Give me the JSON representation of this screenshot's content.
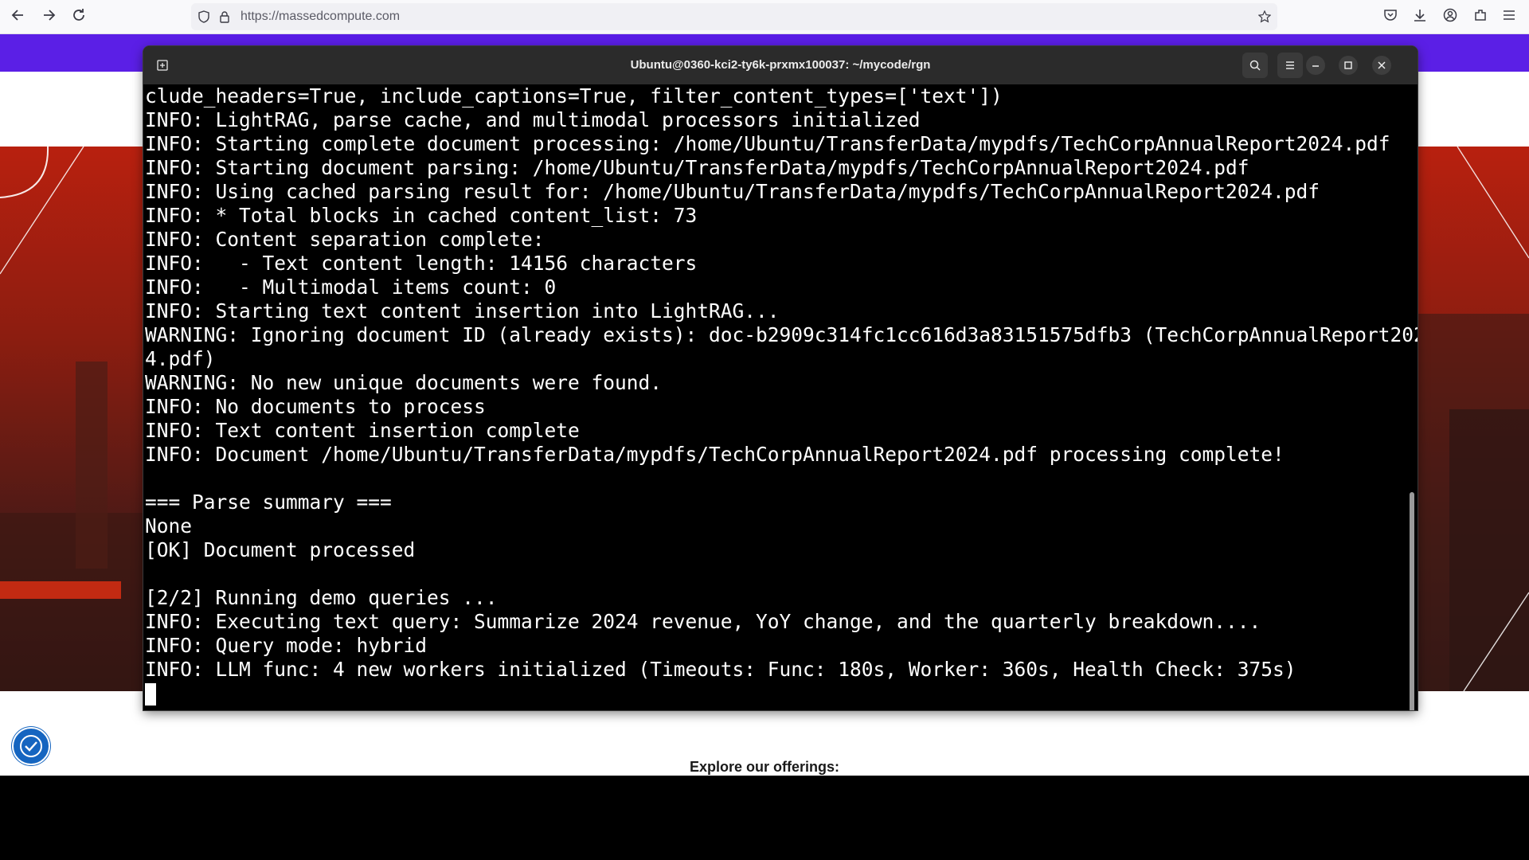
{
  "browser": {
    "url": "https://massedcompute.com"
  },
  "terminal": {
    "title": "Ubuntu@0360-kci2-ty6k-prxmx100037: ~/mycode/rgn",
    "lines": [
      "clude_headers=True, include_captions=True, filter_content_types=['text'])",
      "INFO: LightRAG, parse cache, and multimodal processors initialized",
      "INFO: Starting complete document processing: /home/Ubuntu/TransferData/mypdfs/TechCorpAnnualReport2024.pdf",
      "INFO: Starting document parsing: /home/Ubuntu/TransferData/mypdfs/TechCorpAnnualReport2024.pdf",
      "INFO: Using cached parsing result for: /home/Ubuntu/TransferData/mypdfs/TechCorpAnnualReport2024.pdf",
      "INFO: * Total blocks in cached content_list: 73",
      "INFO: Content separation complete:",
      "INFO:   - Text content length: 14156 characters",
      "INFO:   - Multimodal items count: 0",
      "INFO: Starting text content insertion into LightRAG...",
      "WARNING: Ignoring document ID (already exists): doc-b2909c314fc1cc616d3a83151575dfb3 (TechCorpAnnualReport202",
      "4.pdf)",
      "WARNING: No new unique documents were found.",
      "INFO: No documents to process",
      "INFO: Text content insertion complete",
      "INFO: Document /home/Ubuntu/TransferData/mypdfs/TechCorpAnnualReport2024.pdf processing complete!",
      "",
      "=== Parse summary ===",
      "None",
      "[OK] Document processed",
      "",
      "[2/2] Running demo queries ...",
      "INFO: Executing text query: Summarize 2024 revenue, YoY change, and the quarterly breakdown....",
      "INFO: Query mode: hybrid",
      "INFO: LLM func: 4 new workers initialized (Timeouts: Func: 180s, Worker: 360s, Health Check: 375s)"
    ]
  },
  "site": {
    "explore_text": "Explore our offerings:"
  },
  "icons": {
    "back": "arrow-left-icon",
    "forward": "arrow-right-icon",
    "reload": "reload-icon",
    "shield": "shield-icon",
    "lock": "lock-icon",
    "bookmark": "star-icon",
    "pocket": "pocket-icon",
    "download": "download-icon",
    "account": "account-icon",
    "extensions": "puzzle-icon",
    "menu": "hamburger-icon",
    "accessibility": "accessibility-icon"
  },
  "colors": {
    "site_purple": "#5b1fe6",
    "hero_red": "#b8200f",
    "terminal_bg": "#000000",
    "terminal_text": "#ffffff"
  }
}
